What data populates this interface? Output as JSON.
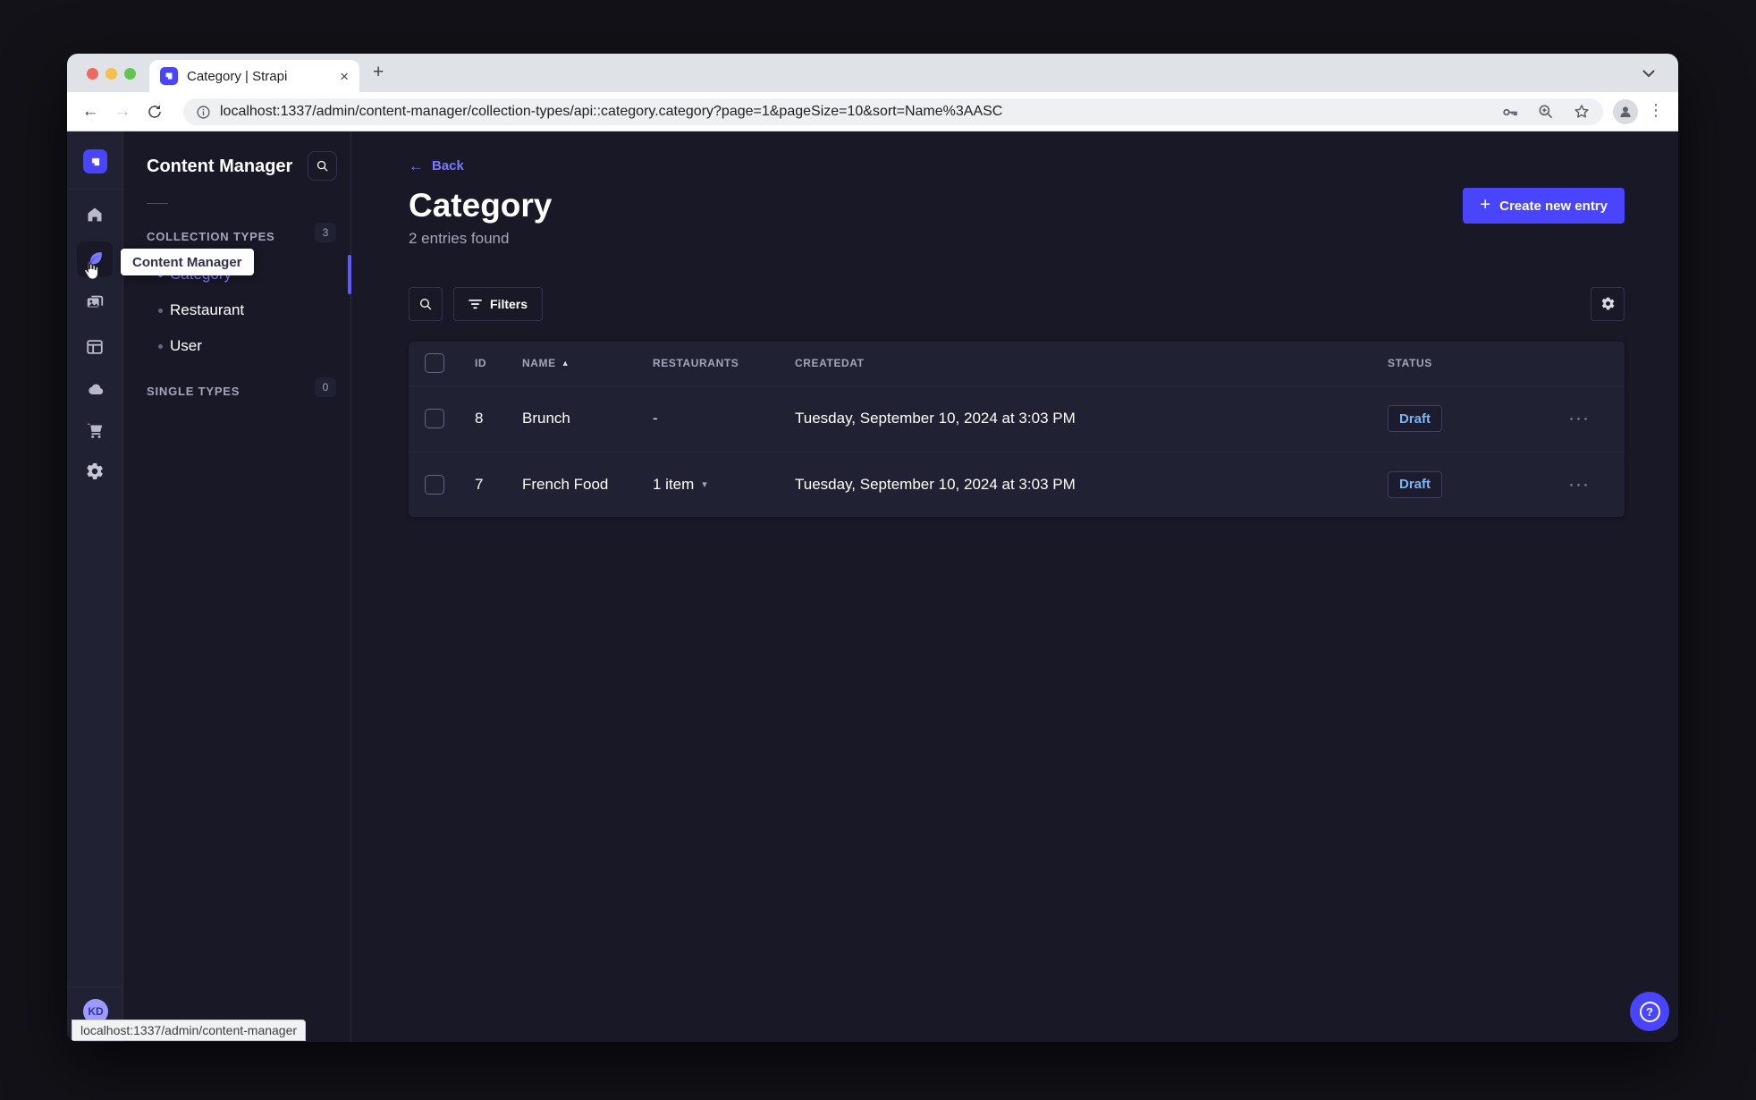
{
  "window": {
    "tab_title": "Category | Strapi",
    "tab_close": "×",
    "new_tab": "+",
    "back_glyph": "←",
    "forward_glyph": "→",
    "url": "localhost:1337/admin/content-manager/collection-types/api::category.category?page=1&pageSize=10&sort=Name%3AASC",
    "menu_dots": "⋮",
    "status_link": "localhost:1337/admin/content-manager"
  },
  "nav_rail": {
    "workspace_initials": "KD",
    "tooltip": "Content Manager"
  },
  "panel": {
    "title": "Content Manager",
    "collection_types": {
      "label": "COLLECTION TYPES",
      "count": "3"
    },
    "items": [
      {
        "label": "Category"
      },
      {
        "label": "Restaurant"
      },
      {
        "label": "User"
      }
    ],
    "single_types": {
      "label": "SINGLE TYPES",
      "count": "0"
    }
  },
  "main": {
    "back_label": "Back",
    "back_arrow": "←",
    "title": "Category",
    "subtitle": "2 entries found",
    "create_button": "Create new entry",
    "create_plus": "+",
    "filters_button": "Filters",
    "help_label": "?",
    "table": {
      "headers": {
        "id": "ID",
        "name": "NAME",
        "restaurants": "RESTAURANTS",
        "created_at": "CREATEDAT",
        "status": "STATUS"
      },
      "sort_triangle": "▲",
      "row_menu_glyph": "···",
      "rows": [
        {
          "id": "8",
          "name": "Brunch",
          "restaurants": "-",
          "created_at": "Tuesday, September 10, 2024 at 3:03 PM",
          "status": "Draft"
        },
        {
          "id": "7",
          "name": "French Food",
          "restaurants": "1 item",
          "restaurants_caret": "▾",
          "created_at": "Tuesday, September 10, 2024 at 3:03 PM",
          "status": "Draft"
        }
      ]
    }
  },
  "colors": {
    "primary": "#4945ff",
    "primary_text": "#7b79ff",
    "draft_text": "#7cb6f2",
    "app_bg": "#181826",
    "card_bg": "#212134"
  }
}
